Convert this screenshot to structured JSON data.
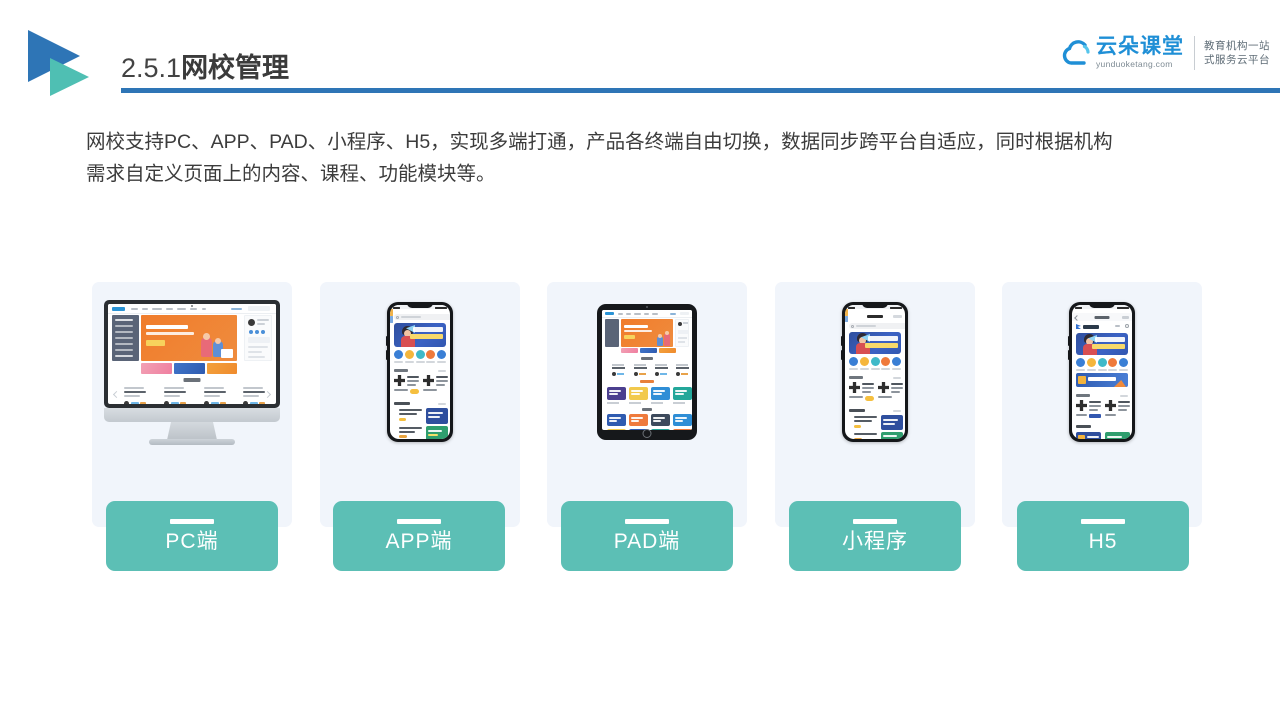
{
  "slide": {
    "header": {
      "section_number": "2.5.1",
      "title_zh": "网校管理",
      "arrow_logo_icon": "triangle-play-logo-icon",
      "rule_color": "#2E75B6"
    },
    "brand": {
      "cloud_icon": "cloud-logo-icon",
      "name": "云朵课堂",
      "url": "yunduoketang.com",
      "tagline_line1": "教育机构一站",
      "tagline_line2": "式服务云平台",
      "name_color": "#1F8FD6"
    },
    "body": {
      "paragraph_line1": "网校支持PC、APP、PAD、小程序、H5，实现多端打通，产品各终端自由切换，数据同步跨平台自适应，同时根据机构",
      "paragraph_line2": "需求自定义页面上的内容、课程、功能模块等。"
    },
    "cards": [
      {
        "label": "PC端",
        "device": "desktop",
        "device_icon": "desktop-monitor-icon",
        "card_bg": "#F1F5FB",
        "label_bg": "#5CBFB5"
      },
      {
        "label": "APP端",
        "device": "phone",
        "device_icon": "smartphone-icon",
        "card_bg": "#F1F5FB",
        "label_bg": "#5CBFB5"
      },
      {
        "label": "PAD端",
        "device": "tablet",
        "device_icon": "tablet-icon",
        "card_bg": "#F1F5FB",
        "label_bg": "#5CBFB5"
      },
      {
        "label": "小程序",
        "device": "phone",
        "device_icon": "smartphone-icon",
        "card_bg": "#F1F5FB",
        "label_bg": "#5CBFB5"
      },
      {
        "label": "H5",
        "device": "phone",
        "device_icon": "smartphone-icon",
        "card_bg": "#F1F5FB",
        "label_bg": "#5CBFB5"
      }
    ]
  }
}
